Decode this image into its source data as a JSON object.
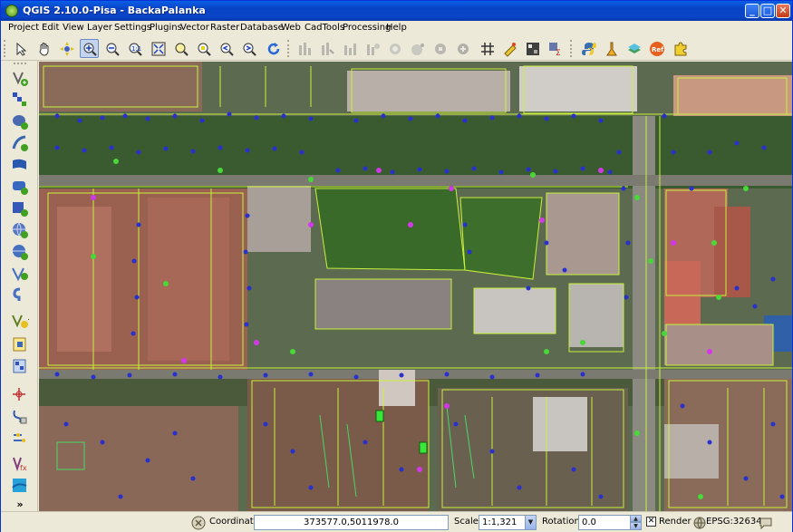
{
  "window": {
    "title": "QGIS 2.10.0-Pisa - BackaPalanka",
    "minimize": "_",
    "maximize": "□",
    "close": "✕"
  },
  "menu": [
    "Project",
    "Edit",
    "View",
    "Layer",
    "Settings",
    "Plugins",
    "Vector",
    "Raster",
    "Database",
    "Web",
    "CadTools",
    "Processing",
    "Help"
  ],
  "toolbar": {
    "icons": [
      "pan-select-icon",
      "pan-hand-icon",
      "pan-to-selection-icon",
      "zoom-in-icon",
      "zoom-out-icon",
      "zoom-native-icon",
      "zoom-full-icon",
      "zoom-layer-icon",
      "zoom-selection-icon",
      "zoom-last-icon",
      "zoom-next-icon",
      "refresh-icon",
      "select-icon",
      "select-radius-icon",
      "deselect-icon",
      "identify-icon",
      "measure-icon",
      "measure-area-icon",
      "measure-angle-icon",
      "grid-icon",
      "annotation-icon",
      "statistics-icon",
      "field-calc-icon",
      "python-icon",
      "plugin-tool-icon",
      "layer-tool-icon",
      "ref-icon",
      "puzzle-icon"
    ],
    "ref_label": "Ref"
  },
  "left_toolbar": {
    "icons": [
      "add-vector-icon",
      "add-raster-icon",
      "add-postgis-icon",
      "add-spatialite-icon",
      "add-wms-icon",
      "add-wcs-icon",
      "add-wfs-icon",
      "add-delimited-icon",
      "add-mssql-icon",
      "add-oracle-icon",
      "add-db2-icon",
      "new-layer-icon",
      "new-spatialite-icon",
      "new-memory-icon",
      "digitize-icon",
      "node-tool-icon",
      "move-feature-icon",
      "gps-icon",
      "expand-icon"
    ],
    "expand_label": "»"
  },
  "statusbar": {
    "coordinate_label": "Coordinate:",
    "coordinate_value": "373577.0,5011978.0",
    "scale_label": "Scale",
    "scale_value": "1:1,321",
    "rotation_label": "Rotation:",
    "rotation_value": "0.0",
    "render_label": "Render",
    "render_checked": "✕",
    "crs_label": "EPSG:32634"
  },
  "colors": {
    "title_bar": "#0a5fe6",
    "vector_lines": "#c8f03c",
    "points_blue": "#2830d0",
    "points_green": "#48d838",
    "points_magenta": "#d038e8"
  }
}
